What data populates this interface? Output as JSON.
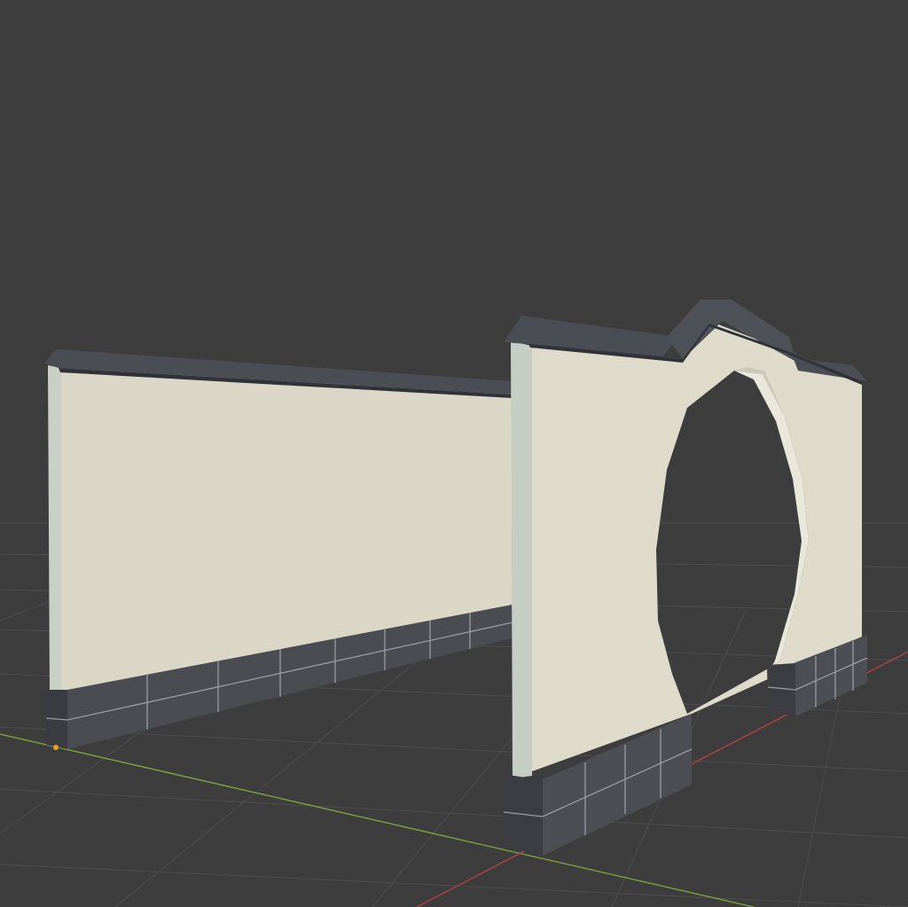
{
  "viewport": {
    "background": "#3d3d3d",
    "grid_color": "#4a4a4a",
    "x_axis_color": "#b0433f",
    "y_axis_color": "#7ea33a",
    "origin_color": "#f0a020"
  },
  "model": {
    "plaster_color": "#dcd9c9",
    "plaster_edge_color": "#eae8dc",
    "roof_tile_color": "#4a4d54",
    "roof_tile_dark": "#33363b",
    "stone_base_color": "#4a4c52",
    "stone_joint_color": "#9a9ca3",
    "opening_shape": "moon-gate"
  }
}
